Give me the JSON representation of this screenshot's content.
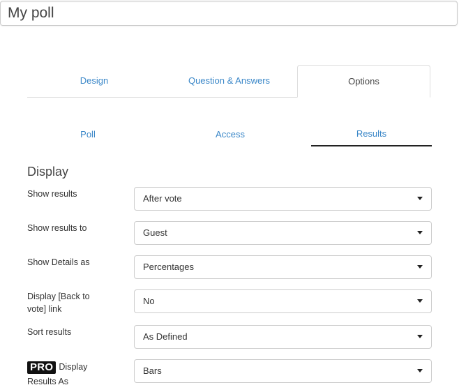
{
  "poll_title": "My poll",
  "main_tabs": [
    {
      "label": "Design",
      "active": false
    },
    {
      "label": "Question & Answers",
      "active": false
    },
    {
      "label": "Options",
      "active": true
    }
  ],
  "sub_tabs": [
    {
      "label": "Poll",
      "active": false
    },
    {
      "label": "Access",
      "active": false
    },
    {
      "label": "Results",
      "active": true
    }
  ],
  "section": {
    "heading": "Display"
  },
  "fields": {
    "show_results": {
      "label": "Show results",
      "value": "After vote"
    },
    "show_results_to": {
      "label": "Show results to",
      "value": "Guest"
    },
    "show_details_as": {
      "label": "Show Details as",
      "value": "Percentages"
    },
    "back_to_vote_link": {
      "label": "Display [Back to vote] link",
      "value": "No"
    },
    "sort_results": {
      "label": "Sort results",
      "value": "As Defined"
    },
    "display_results_as": {
      "badge": "PRO",
      "label": "Display Results As",
      "value": "Bars"
    }
  },
  "colors": {
    "link": "#3a87c8",
    "active_underline": "#222222",
    "border": "#cccccc"
  }
}
